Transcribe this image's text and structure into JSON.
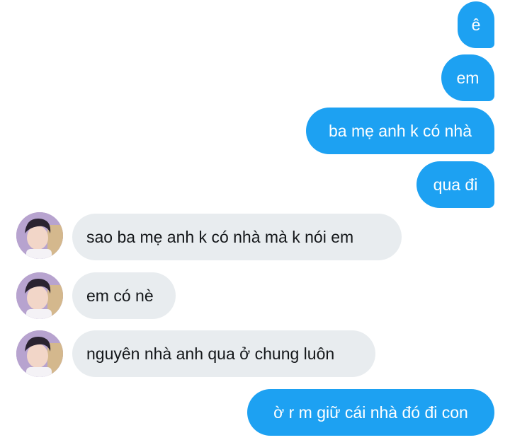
{
  "messages": [
    {
      "side": "sent",
      "text": "ê"
    },
    {
      "side": "sent",
      "text": "em"
    },
    {
      "side": "sent",
      "text": "ba mẹ anh k có nhà"
    },
    {
      "side": "sent",
      "text": "qua đi"
    },
    {
      "side": "received",
      "text": "sao ba mẹ anh k có nhà mà k nói em"
    },
    {
      "side": "received",
      "text": "em có nè"
    },
    {
      "side": "received",
      "text": "nguyên nhà anh qua ở chung luôn"
    },
    {
      "side": "sent",
      "text": "ờ r m giữ cái nhà đó đi con"
    }
  ],
  "colors": {
    "sent_bubble": "#1da1f2",
    "received_bubble": "#e8ecef",
    "sent_text": "#ffffff",
    "received_text": "#14171a"
  },
  "icons": {
    "avatar": "user-avatar-photo"
  }
}
